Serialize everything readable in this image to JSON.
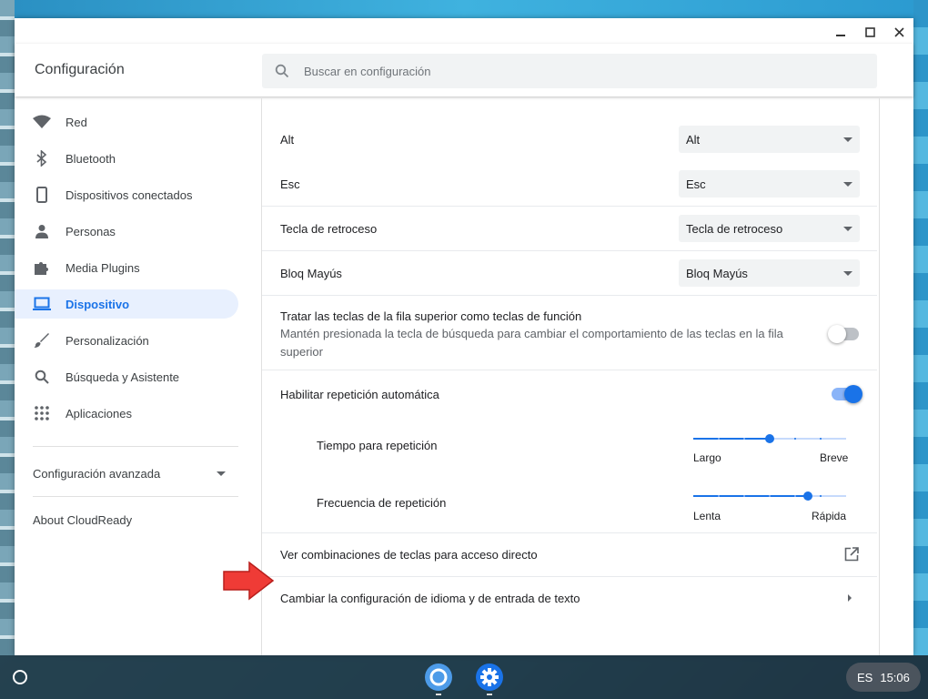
{
  "window": {
    "title": "Configuración"
  },
  "search": {
    "placeholder": "Buscar en configuración"
  },
  "sidebar": {
    "items": [
      {
        "label": "Red",
        "icon": "wifi-icon"
      },
      {
        "label": "Bluetooth",
        "icon": "bluetooth-icon"
      },
      {
        "label": "Dispositivos conectados",
        "icon": "phone-icon"
      },
      {
        "label": "Personas",
        "icon": "person-icon"
      },
      {
        "label": "Media Plugins",
        "icon": "puzzle-icon"
      },
      {
        "label": "Dispositivo",
        "icon": "laptop-icon",
        "active": true
      },
      {
        "label": "Personalización",
        "icon": "brush-icon"
      },
      {
        "label": "Búsqueda y Asistente",
        "icon": "search-icon"
      },
      {
        "label": "Aplicaciones",
        "icon": "apps-grid-icon"
      }
    ],
    "advanced": "Configuración avanzada",
    "about": "About CloudReady"
  },
  "keyboard": {
    "remaps": [
      {
        "label": "Alt",
        "value": "Alt"
      },
      {
        "label": "Esc",
        "value": "Esc"
      },
      {
        "label": "Tecla de retroceso",
        "value": "Tecla de retroceso"
      },
      {
        "label": "Bloq Mayús",
        "value": "Bloq Mayús"
      }
    ],
    "function_keys": {
      "label": "Tratar las teclas de la fila superior como teclas de función",
      "sublabel": "Mantén presionada la tecla de búsqueda para cambiar el comportamiento de las teclas en la fila superior",
      "enabled": false
    },
    "auto_repeat": {
      "label": "Habilitar repetición automática",
      "enabled": true
    },
    "repeat_delay": {
      "label": "Tiempo para repetición",
      "min_label": "Largo",
      "max_label": "Breve",
      "value_fraction": 0.5
    },
    "repeat_rate": {
      "label": "Frecuencia de repetición",
      "min_label": "Lenta",
      "max_label": "Rápida",
      "value_fraction": 0.75
    },
    "shortcuts": {
      "label": "Ver combinaciones de teclas para acceso directo"
    },
    "language": {
      "label": "Cambiar la configuración de idioma y de entrada de texto"
    }
  },
  "shelf": {
    "locale": "ES",
    "time": "15:06"
  },
  "colors": {
    "accent": "#1a73e8",
    "annotation_arrow": "#ef3b36"
  }
}
